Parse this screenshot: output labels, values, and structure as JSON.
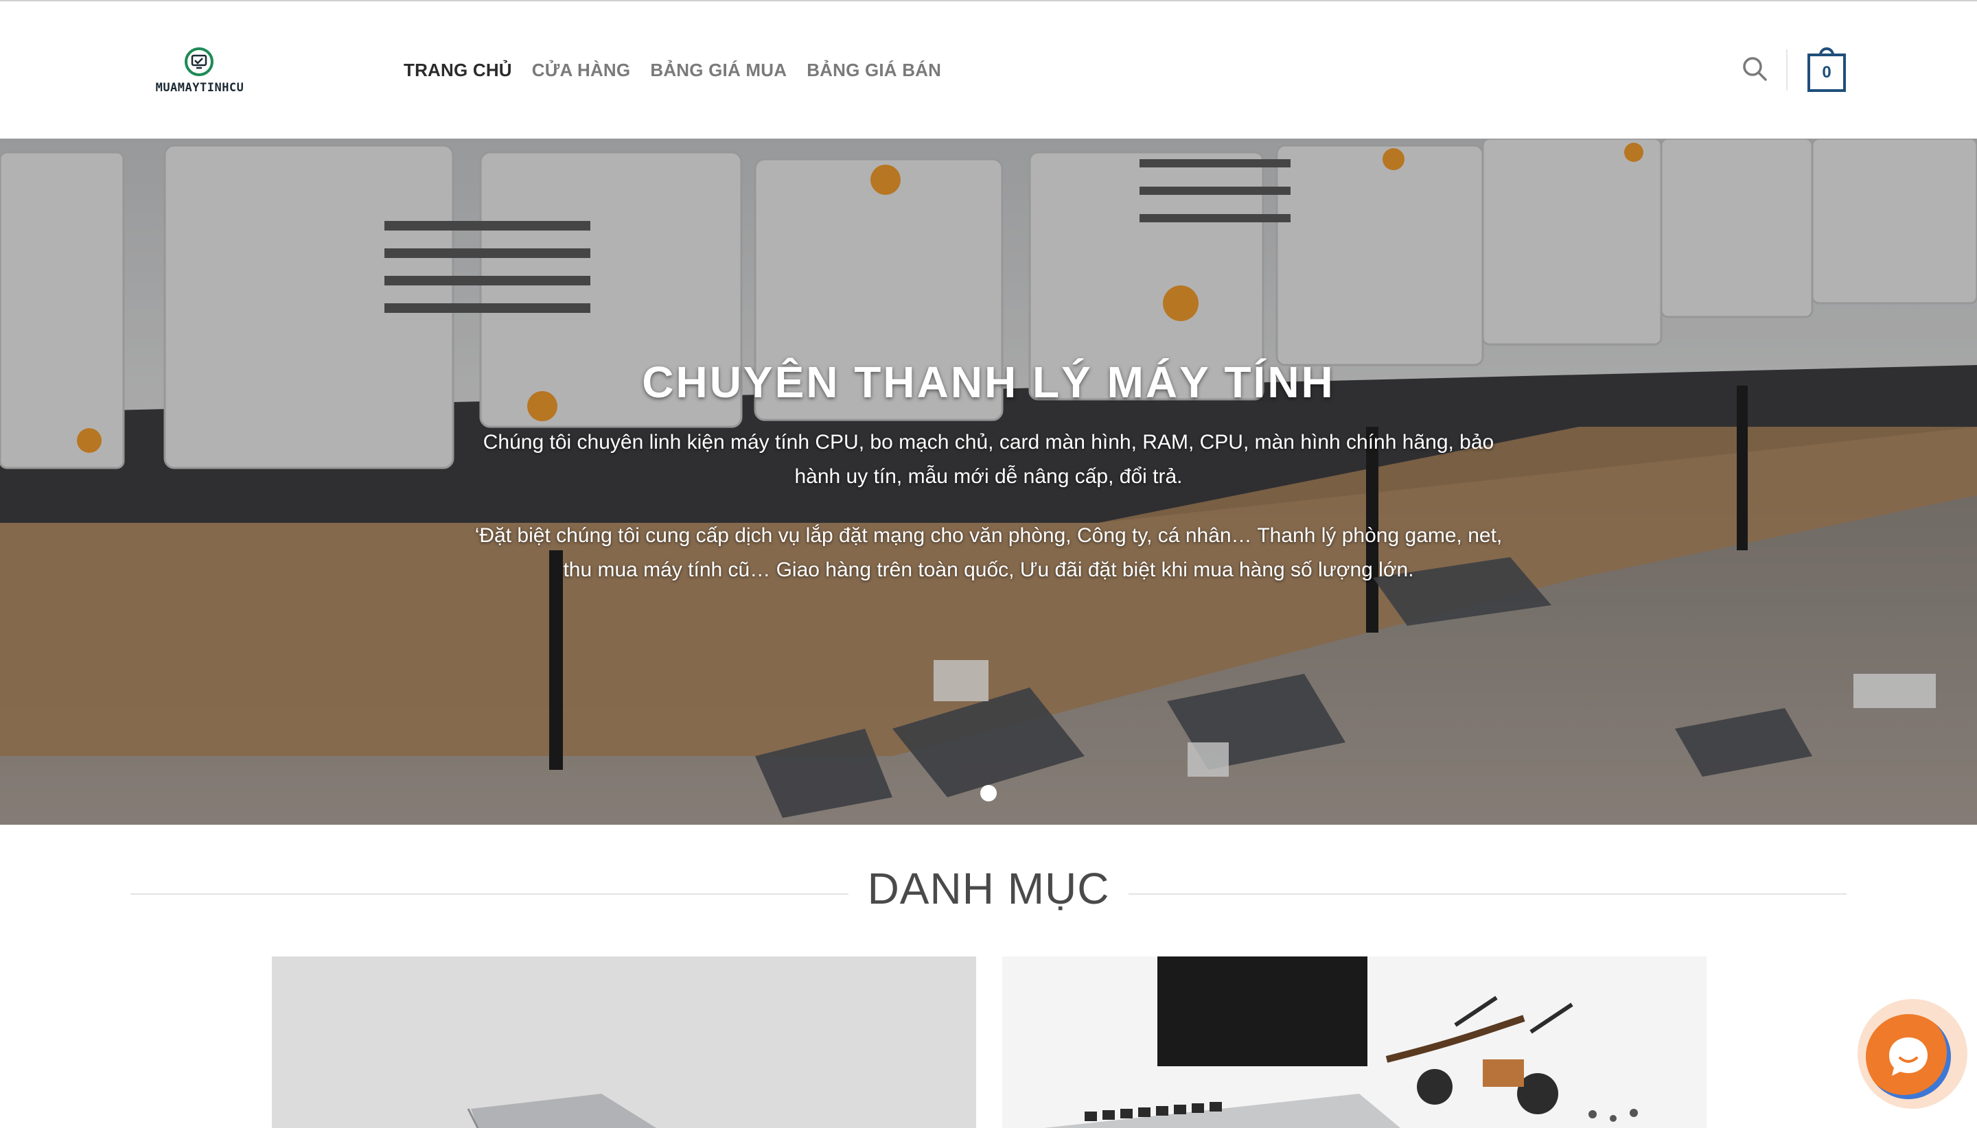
{
  "brand": {
    "logo_text": "MUAMAYTINHCU"
  },
  "nav": {
    "items": [
      {
        "label": "TRANG CHỦ",
        "active": true
      },
      {
        "label": "CỬA HÀNG",
        "active": false
      },
      {
        "label": "BẢNG GIÁ MUA",
        "active": false
      },
      {
        "label": "BẢNG GIÁ BÁN",
        "active": false
      }
    ]
  },
  "header": {
    "search_icon": "search-icon",
    "cart_count": "0"
  },
  "hero": {
    "title": "CHUYÊN THANH LÝ MÁY TÍNH",
    "paragraph1": "Chúng tôi chuyên linh kiện máy tính CPU, bo mạch chủ, card màn hình, RAM, CPU, màn hình chính hãng, bảo hành uy tín, mẫu mới dễ nâng cấp, đổi trả.",
    "paragraph2": "‘Đặt biệt chúng tôi cung cấp dịch vụ lắp đặt mạng cho văn phòng, Công ty, cá nhân… Thanh lý phòng game, net, thu mua máy tính cũ… Giao hàng trên toàn quốc, Ưu đãi đặt biệt khi mua hàng số lượng lớn.",
    "slide_count": 1,
    "active_slide": 1
  },
  "section": {
    "title": "DANH MỤC"
  },
  "colors": {
    "accent_dark": "#1f4f7a",
    "logo_green": "#1e8a55",
    "chat_orange": "#ee7a2a",
    "chat_blue": "#3c78d8"
  }
}
